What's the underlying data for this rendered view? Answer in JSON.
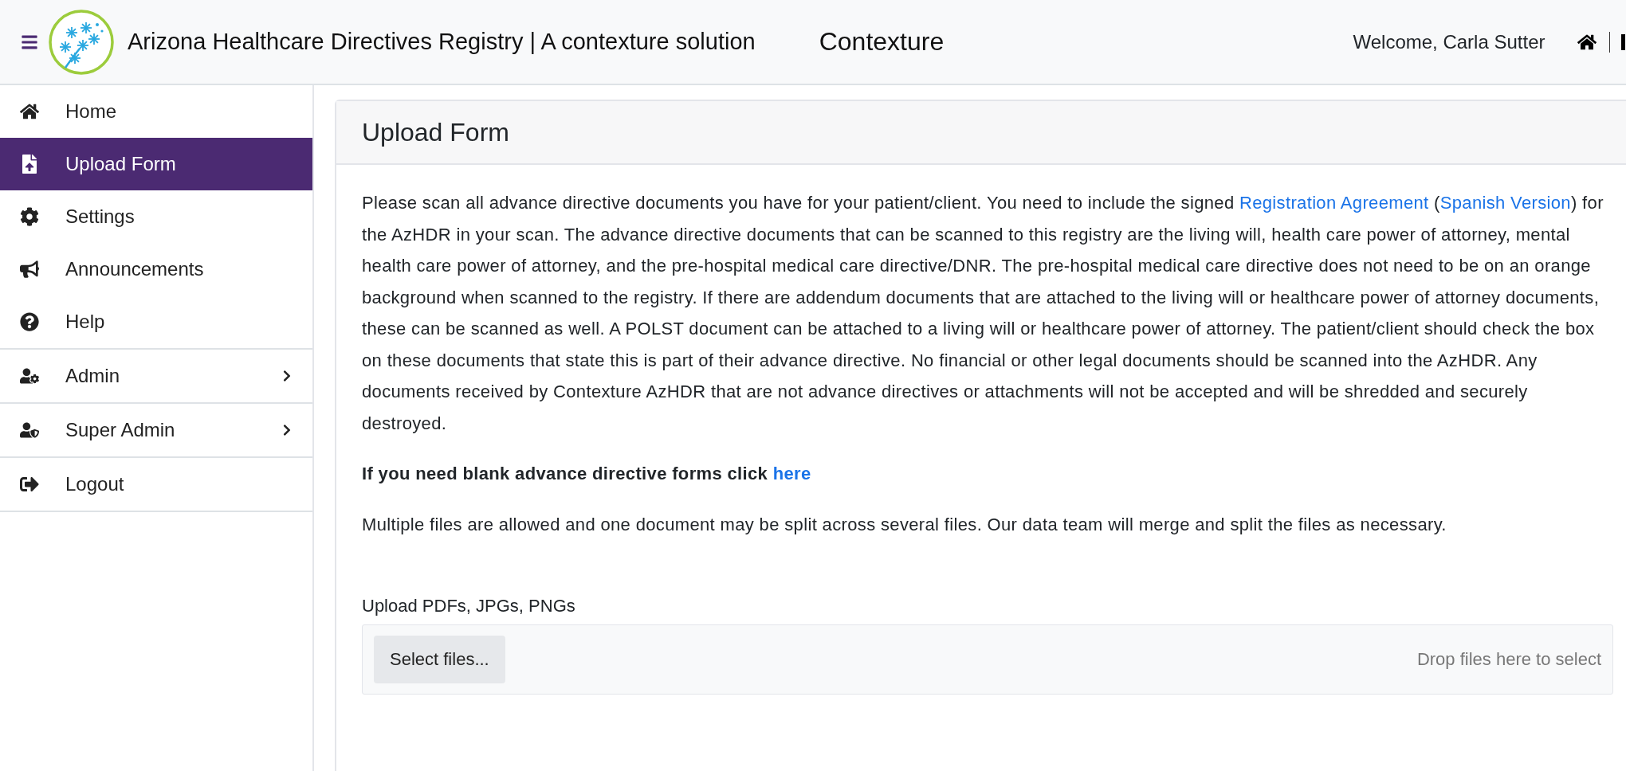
{
  "header": {
    "title": "Arizona Healthcare Directives Registry | A contexture solution",
    "brand": "Contexture",
    "welcome": "Welcome, Carla Sutter"
  },
  "sidebar": {
    "groups": [
      {
        "items": [
          {
            "label": "Home",
            "kind": "page",
            "selected": false
          },
          {
            "label": "Upload Form",
            "kind": "page",
            "selected": true
          },
          {
            "label": "Settings",
            "kind": "page",
            "selected": false
          },
          {
            "label": "Announcements",
            "kind": "page",
            "selected": false
          },
          {
            "label": "Help",
            "kind": "page",
            "selected": false
          }
        ]
      },
      {
        "items": [
          {
            "label": "Admin",
            "kind": "submenu",
            "selected": false
          }
        ]
      },
      {
        "items": [
          {
            "label": "Super Admin",
            "kind": "submenu",
            "selected": false
          }
        ]
      },
      {
        "items": [
          {
            "label": "Logout",
            "kind": "page",
            "selected": false
          }
        ]
      }
    ]
  },
  "card": {
    "title": "Upload Form",
    "intro": [
      {
        "kind": "text",
        "text": "Please scan all advance directive documents you have for your patient/client. You need to include the signed "
      },
      {
        "kind": "link",
        "text": "Registration Agreement"
      },
      {
        "kind": "text",
        "text": " ("
      },
      {
        "kind": "link",
        "text": "Spanish Version"
      },
      {
        "kind": "text",
        "text": ") for the AzHDR in your scan. The advance directive documents that can be scanned to this registry are the living will, health care power of attorney, mental health care power of attorney, and the pre-hospital medical care directive/DNR. The pre-hospital medical care directive does not need to be on an orange background when scanned to the registry. If there are addendum documents that are attached to the living will or healthcare power of attorney documents, these can be scanned as well. A POLST document can be attached to a living will or healthcare power of attorney. The patient/client should check the box on these documents that state this is part of their advance directive. No financial or other legal documents should be scanned into the AzHDR. Any documents received by Contexture AzHDR that are not advance directives or attachments will not be accepted and will be shredded and securely destroyed."
      }
    ],
    "blank_forms": [
      {
        "kind": "text",
        "text": "If you need blank advance directive forms click "
      },
      {
        "kind": "link",
        "text": "here"
      }
    ],
    "note": "Multiple files are allowed and one document may be split across several files. Our data team will merge and split the files as necessary.",
    "upload": {
      "label": "Upload PDFs, JPGs, PNGs",
      "button": "Select files...",
      "hint": "Drop files here to select"
    }
  }
}
